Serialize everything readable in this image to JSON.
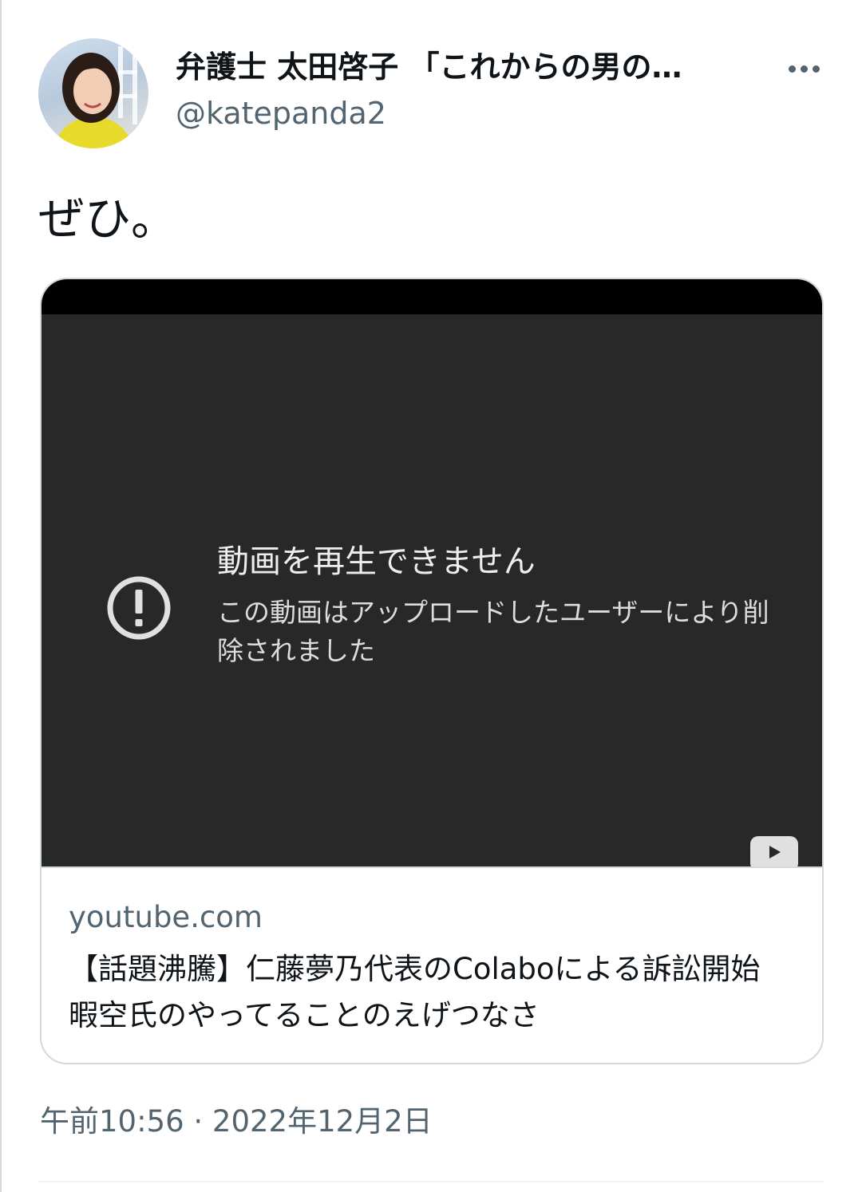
{
  "tweet": {
    "author": {
      "display_name": "弁護士 太田啓子 「これからの男の…",
      "handle": "@katepanda2"
    },
    "text": "ぜひ。",
    "timestamp": "午前10:56 · 2022年12月2日"
  },
  "card": {
    "video": {
      "error_title": "動画を再生できません",
      "error_message": "この動画はアップロードしたユーザーにより削除されました"
    },
    "domain": "youtube.com",
    "title": "【話題沸騰】仁藤夢乃代表のColaboによる訴訟開始　暇空氏のやってることのえげつなさ"
  },
  "colors": {
    "text_primary": "#0f1419",
    "text_secondary": "#536471",
    "border": "#cfd9de",
    "video_background": "#282828"
  },
  "icons": [
    "more-icon",
    "error-circle-icon",
    "youtube-play-icon"
  ]
}
